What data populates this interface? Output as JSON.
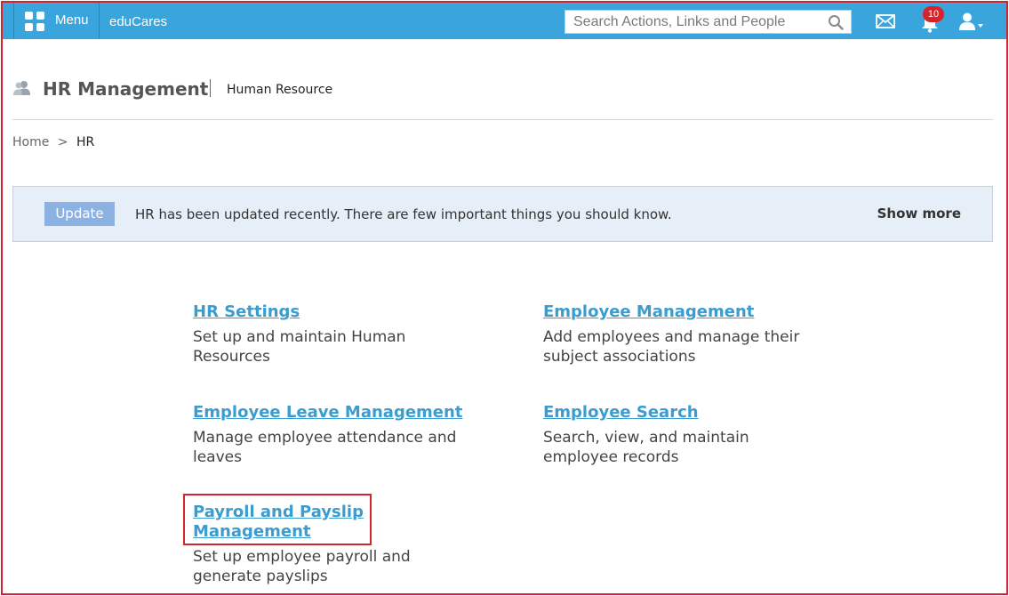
{
  "topbar": {
    "menu_label": "Menu",
    "brand": "eduCares",
    "search_placeholder": "Search Actions, Links and People",
    "notification_count": "10",
    "icons": [
      "grid-menu-icon",
      "search-icon",
      "mail-icon",
      "bell-icon",
      "user-icon"
    ],
    "color": "#3aa5dc"
  },
  "header": {
    "title": "HR Management",
    "subtitle": "Human Resource"
  },
  "breadcrumb": {
    "home": "Home",
    "separator": ">",
    "current": "HR"
  },
  "notice": {
    "tag": "Update",
    "text": "HR has been updated recently. There are few important things you should know.",
    "more": "Show more"
  },
  "modules": [
    {
      "title": "HR Settings",
      "description": "Set up and maintain Human Resources"
    },
    {
      "title": "Employee Management",
      "description": "Add employees and manage their subject associations"
    },
    {
      "title": "Employee Leave Management",
      "description": "Manage employee attendance and leaves"
    },
    {
      "title": "Employee Search",
      "description": "Search, view, and maintain employee records"
    },
    {
      "title": "Payroll and Payslip Management",
      "description": "Set up employee payroll and generate payslips"
    }
  ],
  "colors": {
    "link": "#3a9ccf",
    "highlight_border": "#d0252f",
    "notice_background": "#e6eef8",
    "badge": "#d8232a"
  }
}
